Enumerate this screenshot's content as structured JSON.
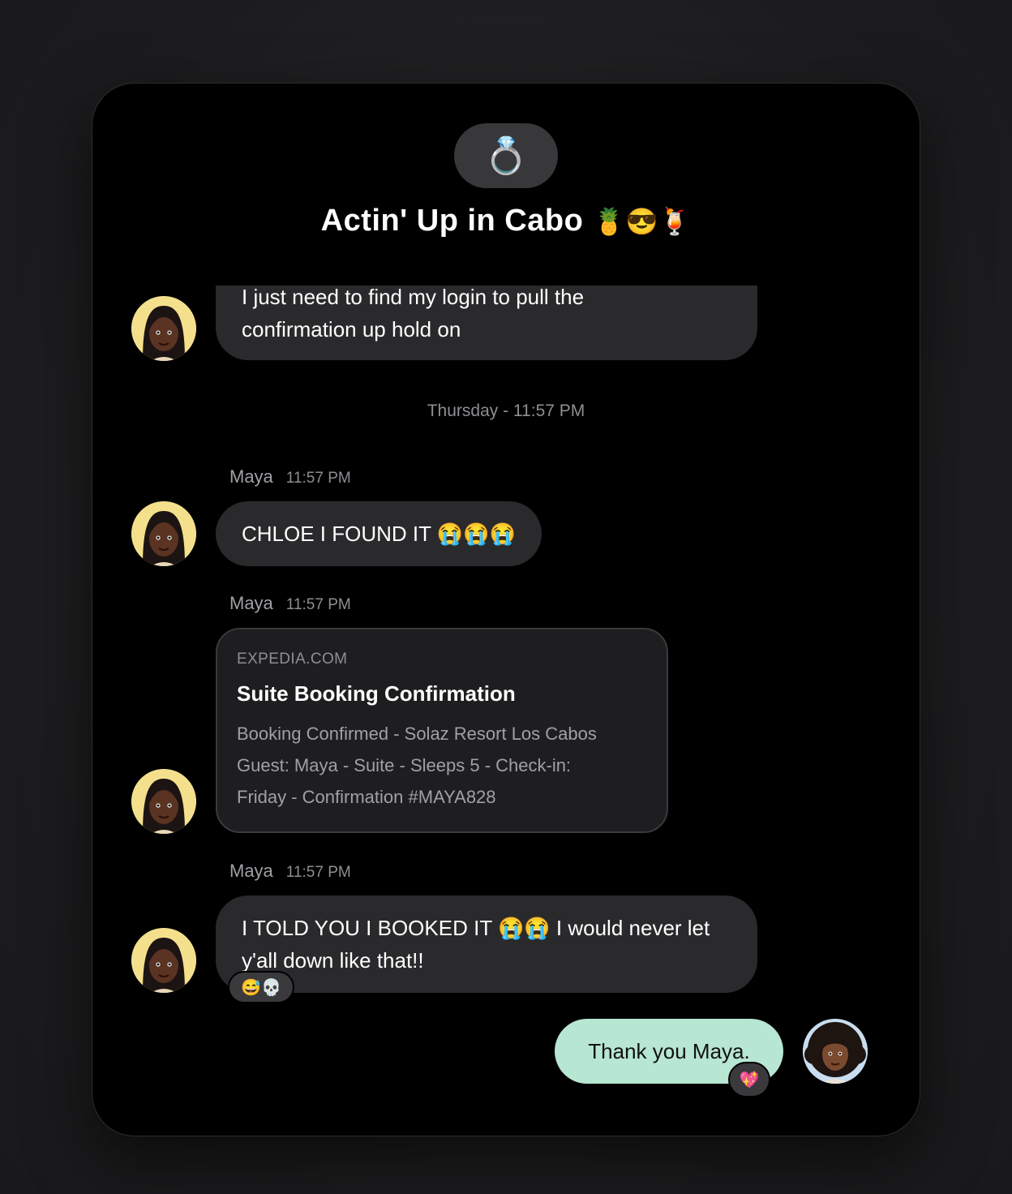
{
  "group": {
    "icon": "ring-icon",
    "icon_glyph": "💍",
    "title": "Actin' Up in Cabo",
    "title_emojis": "🍍😎🍹"
  },
  "messages": {
    "m0": {
      "text_line1": "I just need to find my login to pull the",
      "text_line2": "confirmation up hold on"
    },
    "divider": "Thursday - 11:57 PM",
    "m1": {
      "sender": "Maya",
      "time": "11:57 PM",
      "text": "CHLOE I FOUND IT 😭😭😭"
    },
    "m2": {
      "sender": "Maya",
      "time": "11:57 PM",
      "link": {
        "domain": "EXPEDIA.COM",
        "title": "Suite Booking Confirmation",
        "desc_line1": "Booking Confirmed - Solaz Resort Los Cabos",
        "desc_line2": "Guest: Maya - Suite - Sleeps 5 - Check-in:",
        "desc_line3": "Friday - Confirmation #MAYA828"
      }
    },
    "m3": {
      "sender": "Maya",
      "time": "11:57 PM",
      "text_line1": "I TOLD YOU I BOOKED IT 😭😭 I would never let",
      "text_line2": "y'all down like that!!",
      "reactions": "😅💀"
    },
    "m4": {
      "text": "Thank you Maya.",
      "reactions": "💖",
      "bubble_color": "#b7e6d3"
    }
  },
  "colors": {
    "background": "#000000",
    "bubble": "#2a2a2c",
    "avatar_ring": "#f4e08c"
  }
}
